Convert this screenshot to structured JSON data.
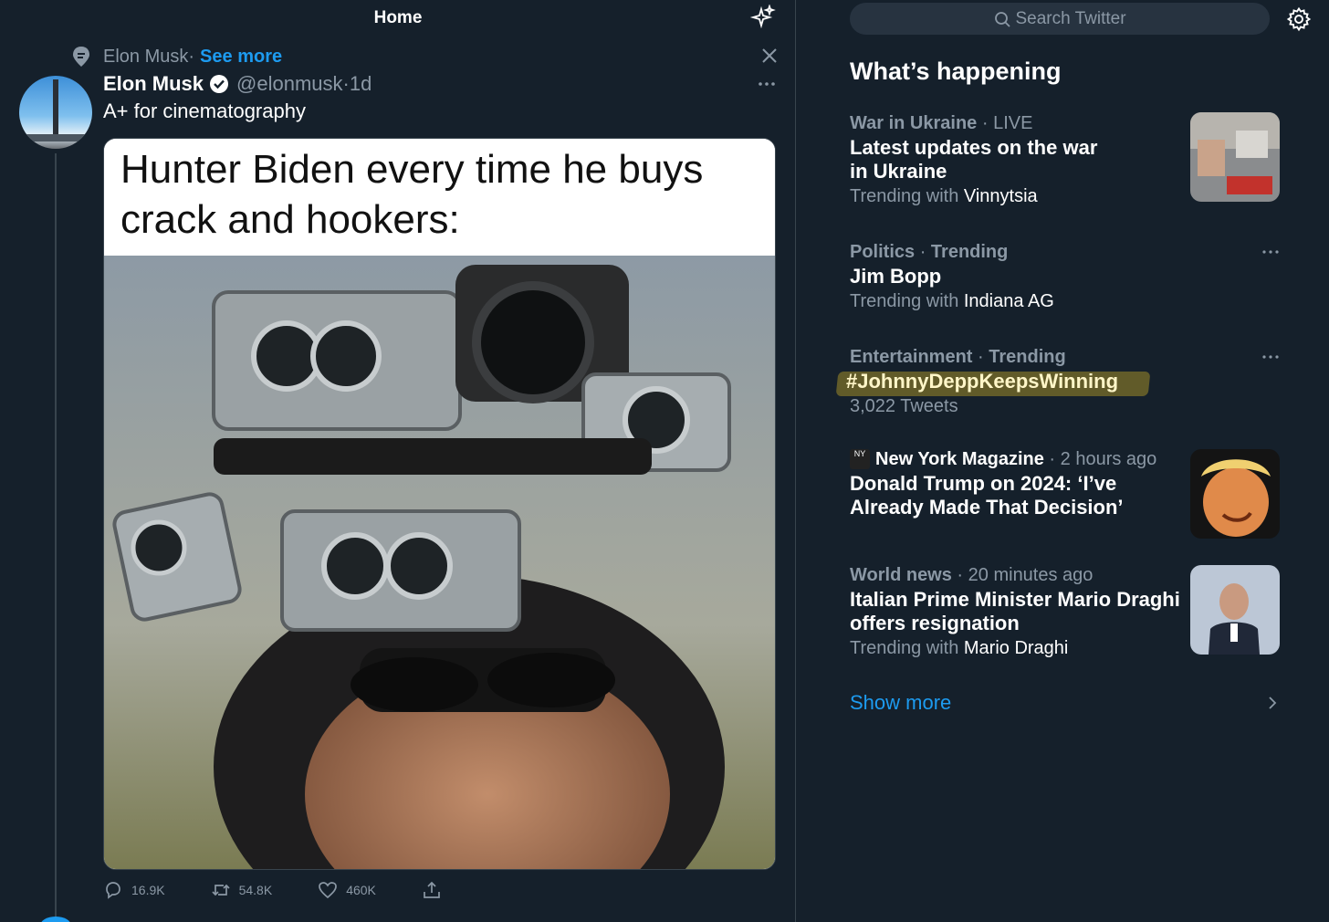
{
  "header": {
    "title": "Home"
  },
  "tweet": {
    "social_context_name": "Elon Musk",
    "social_context_sep": " · ",
    "see_more": "See more",
    "author_name": "Elon Musk",
    "author_handle": "@elonmusk",
    "time_sep": " · ",
    "time": "1d",
    "text": "A+ for cinematography",
    "meme_caption": "Hunter Biden every time he buys crack and hookers:",
    "replies": "16.9K",
    "retweets": "54.8K",
    "likes": "460K"
  },
  "sidebar": {
    "search_placeholder": "Search Twitter",
    "title": "What’s happening",
    "trends": [
      {
        "category": "War in Ukraine",
        "tag": "LIVE",
        "headline": "Latest updates on the war in Ukraine",
        "sub_prefix": "Trending with ",
        "sub_value": "Vinnytsia"
      },
      {
        "category": "Politics",
        "tag": "Trending",
        "headline": "Jim Bopp",
        "sub_prefix": "Trending with ",
        "sub_value": "Indiana AG"
      },
      {
        "category": "Entertainment",
        "tag": "Trending",
        "headline": "#JohnnyDeppKeepsWinning",
        "sub_prefix": "3,022 Tweets",
        "sub_value": ""
      },
      {
        "category": "New York Magazine",
        "tag": "2 hours ago",
        "headline": "Donald Trump on 2024: ‘I’ve Already Made That Decision’",
        "sub_prefix": "",
        "sub_value": ""
      },
      {
        "category": "World news",
        "tag": "20 minutes ago",
        "headline": "Italian Prime Minister Mario Draghi offers resignation",
        "sub_prefix": "Trending with ",
        "sub_value": "Mario Draghi"
      }
    ],
    "show_more": "Show more"
  },
  "colors": {
    "background": "#15202b",
    "accent": "#1d9bf0",
    "muted": "#8b98a5",
    "border": "#38444d"
  },
  "icons": [
    "sparkle-icon",
    "pin-icon",
    "close-icon",
    "verified-icon",
    "more-icon",
    "reply-icon",
    "retweet-icon",
    "like-icon",
    "share-icon",
    "search-icon",
    "gear-icon",
    "chevron-right-icon"
  ]
}
